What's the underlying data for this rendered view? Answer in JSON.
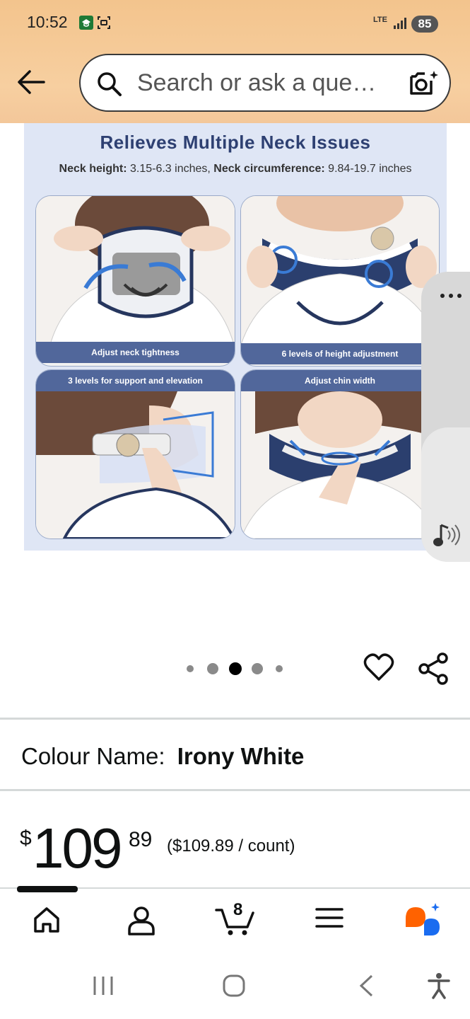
{
  "status_bar": {
    "time": "10:52",
    "network": "LTE",
    "battery": "85"
  },
  "header": {
    "search_placeholder": "Search or ask a que…",
    "icons": [
      "back-arrow-icon",
      "search-icon",
      "camera-search-icon"
    ]
  },
  "product_image": {
    "title": "Relieves Multiple Neck Issues",
    "subtitle_label1": "Neck height:",
    "subtitle_value1": "3.15-6.3 inches,",
    "subtitle_label2": "Neck circumference:",
    "subtitle_value2": "9.84-19.7 inches",
    "panels": [
      {
        "caption": "Adjust neck tightness"
      },
      {
        "caption": "6 levels of height adjustment"
      },
      {
        "caption": "3 levels for support and elevation"
      },
      {
        "caption": "Adjust chin width"
      }
    ]
  },
  "carousel": {
    "dots": 5,
    "active_index": 2
  },
  "product_actions": {
    "icons": [
      "heart-icon",
      "share-icon"
    ]
  },
  "colour": {
    "label": "Colour Name:",
    "value": "Irony White"
  },
  "price": {
    "currency": "$",
    "whole": "109",
    "fraction": "89",
    "unit_price": "($109.89 / count)"
  },
  "bottom_nav": {
    "cart_count": "8",
    "icons": [
      "home-icon",
      "account-icon",
      "cart-icon",
      "menu-icon",
      "rufus-icon"
    ],
    "accent_color": "#ff6200"
  },
  "side_overlay": {
    "icons": [
      "more-icon",
      "music-icon"
    ]
  }
}
